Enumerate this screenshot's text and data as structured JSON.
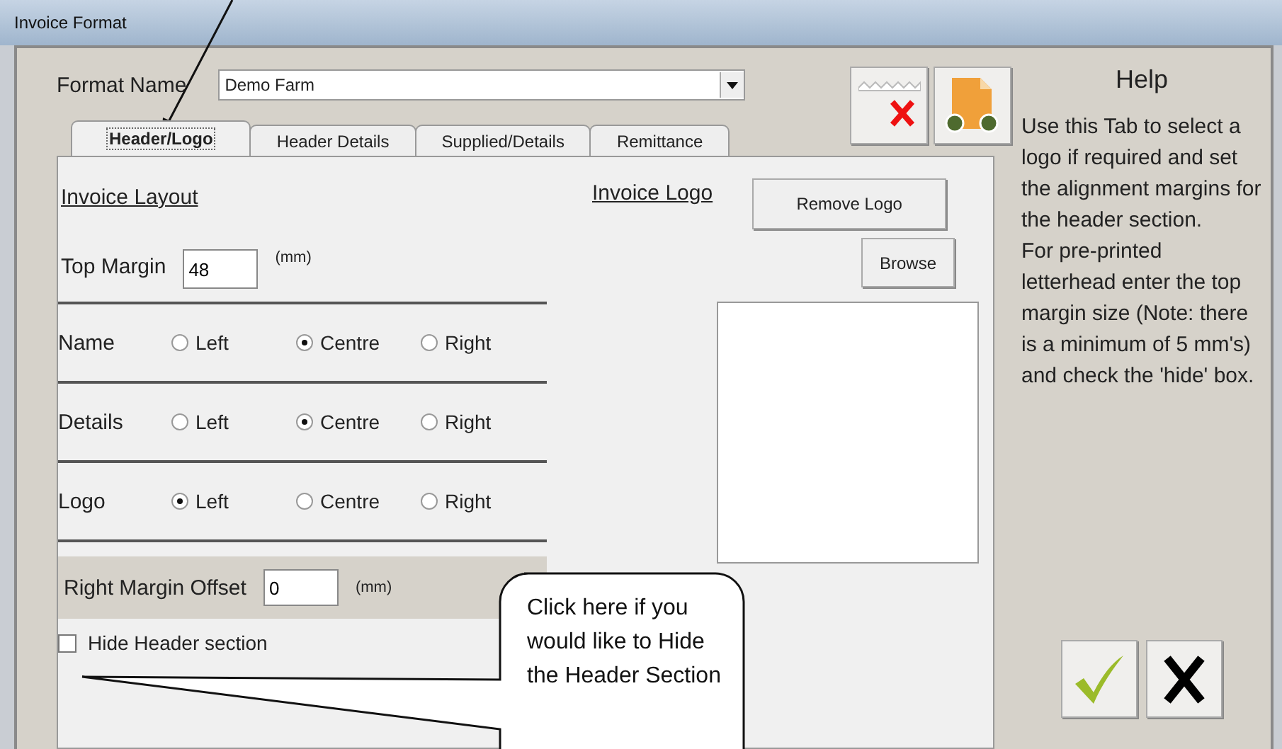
{
  "window": {
    "title": "Invoice Format"
  },
  "format_name": {
    "label": "Format Name",
    "value": "Demo Farm"
  },
  "tabs": [
    {
      "label": "Header/Logo",
      "selected": true
    },
    {
      "label": "Header Details",
      "selected": false
    },
    {
      "label": "Supplied/Details",
      "selected": false
    },
    {
      "label": "Remittance",
      "selected": false
    }
  ],
  "layout": {
    "heading": "Invoice Layout",
    "top_margin": {
      "label": "Top Margin",
      "value": "48",
      "unit": "(mm)"
    },
    "alignment_rows": [
      {
        "label": "Name",
        "options": [
          {
            "label": "Left",
            "selected": false
          },
          {
            "label": "Centre",
            "selected": true
          },
          {
            "label": "Right",
            "selected": false
          }
        ]
      },
      {
        "label": "Details",
        "options": [
          {
            "label": "Left",
            "selected": false
          },
          {
            "label": "Centre",
            "selected": true
          },
          {
            "label": "Right",
            "selected": false
          }
        ]
      },
      {
        "label": "Logo",
        "options": [
          {
            "label": "Left",
            "selected": true
          },
          {
            "label": "Centre",
            "selected": false
          },
          {
            "label": "Right",
            "selected": false
          }
        ]
      }
    ],
    "right_margin_offset": {
      "label": "Right Margin Offset",
      "value": "0",
      "unit": "(mm)"
    },
    "hide_header": {
      "label": "Hide Header section",
      "checked": false
    }
  },
  "logo": {
    "heading": "Invoice Logo",
    "buttons": [
      "Remove Logo",
      "Browse"
    ]
  },
  "help": {
    "title": "Help",
    "paragraphs": [
      "Use this Tab to select a logo if required and set the alignment margins for the header section.",
      "For pre-printed letterhead enter the top margin size (Note: there is a minimum of 5 mm's) and check the 'hide' box."
    ]
  },
  "callout": {
    "text": "Click here if you would like to Hide the Header Section"
  }
}
